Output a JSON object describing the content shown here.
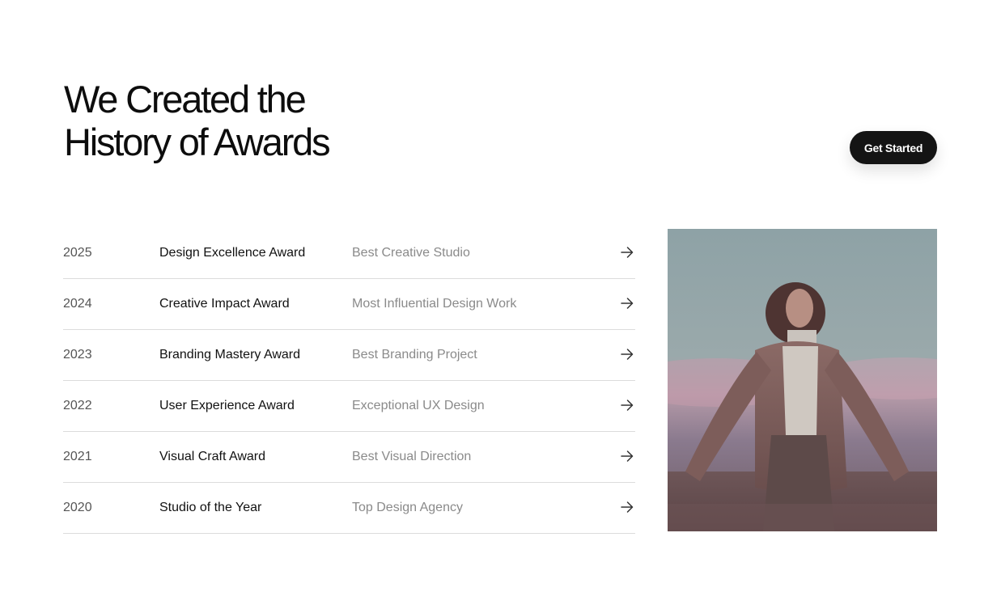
{
  "heading": {
    "line1": "We Created the",
    "line2": "History of Awards"
  },
  "cta": {
    "label": "Get Started"
  },
  "awards": [
    {
      "year": "2025",
      "name": "Design Excellence Award",
      "category": "Best Creative Studio",
      "icon": "arrow-right-icon"
    },
    {
      "year": "2024",
      "name": "Creative Impact Award",
      "category": "Most Influential Design Work",
      "icon": "arrow-right-icon"
    },
    {
      "year": "2023",
      "name": "Branding Mastery Award",
      "category": "Best Branding Project",
      "icon": "arrow-right-icon"
    },
    {
      "year": "2022",
      "name": "User Experience Award",
      "category": "Exceptional UX Design",
      "icon": "arrow-right-icon"
    },
    {
      "year": "2021",
      "name": "Visual Craft Award",
      "category": "Best Visual Direction",
      "icon": "arrow-right-icon"
    },
    {
      "year": "2020",
      "name": "Studio of the Year",
      "category": "Top Design Agency",
      "icon": "arrow-right-icon"
    }
  ],
  "colors": {
    "text": "#111111",
    "muted": "#8a8a8a",
    "button_bg": "#141414",
    "divider": "#dcdcdc"
  }
}
